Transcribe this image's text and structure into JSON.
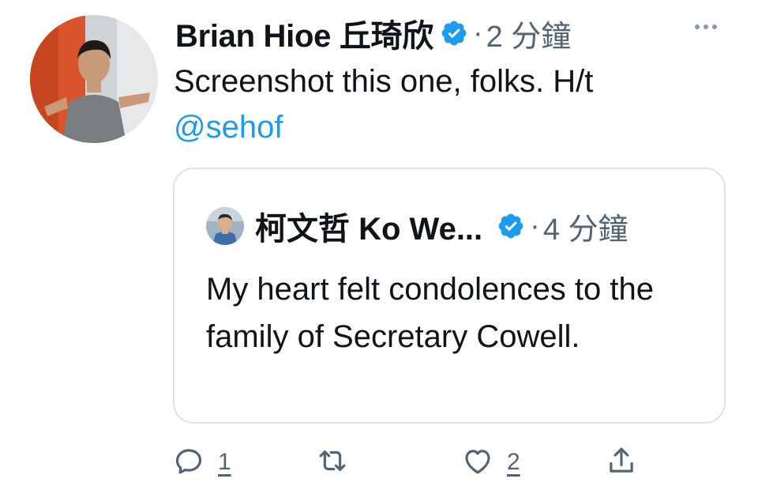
{
  "tweet": {
    "author_name": "Brian Hioe 丘琦欣",
    "separator": "·",
    "time": "2 分鐘",
    "text_before_mention": "Screenshot this one, folks. H/t",
    "mention": "@sehof",
    "verified_color": "#1d9bf0"
  },
  "quoted_tweet": {
    "author_name": "柯文哲 Ko We...",
    "separator": "·",
    "time": "4 分鐘",
    "text": "My heart felt condolences to the family of Secretary Cowell."
  },
  "actions": {
    "reply_count": "1",
    "like_count": "2"
  },
  "icons": [
    "more-options-icon",
    "verified-badge-icon",
    "reply-icon",
    "retweet-icon",
    "like-icon",
    "share-icon"
  ],
  "colors": {
    "accent": "#1d9bf0",
    "secondary_text": "#536471",
    "border": "#dfe3e8"
  }
}
